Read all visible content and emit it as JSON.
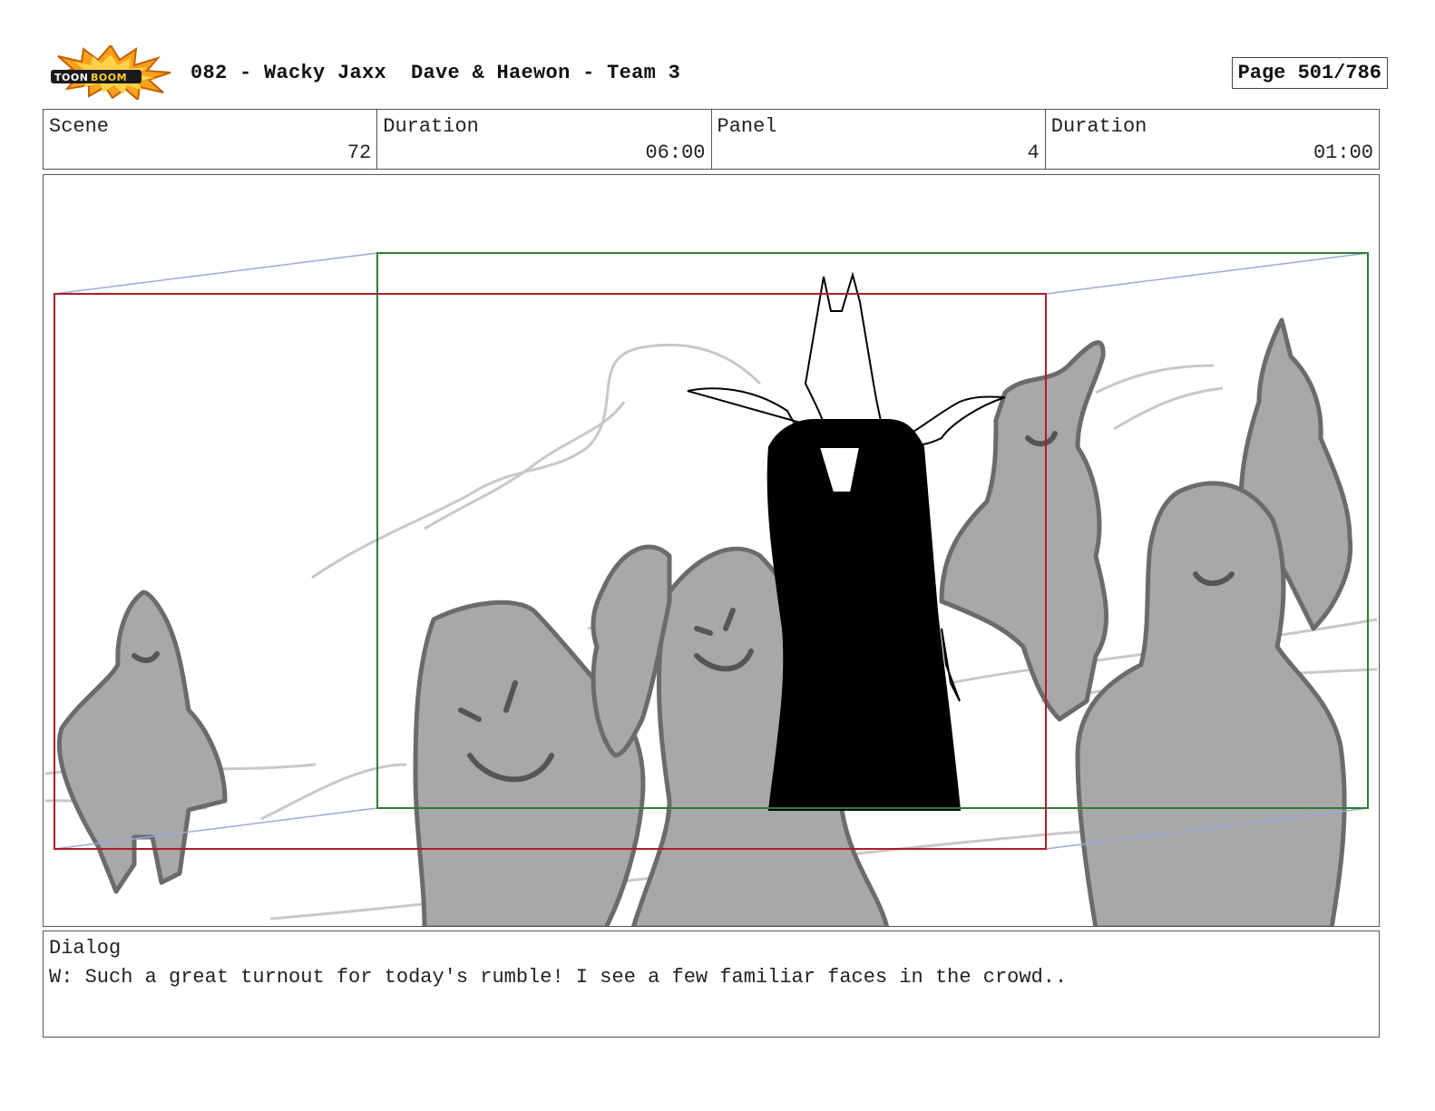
{
  "header": {
    "logo_text": "TOONBOOM",
    "title": "082 - Wacky Jaxx  Dave & Haewon - Team 3",
    "page": "Page 501/786"
  },
  "info": {
    "scene_label": "Scene",
    "scene_value": "72",
    "scene_duration_label": "Duration",
    "scene_duration_value": "06:00",
    "panel_label": "Panel",
    "panel_value": "4",
    "panel_duration_label": "Duration",
    "panel_duration_value": "01:00"
  },
  "dialog": {
    "label": "Dialog",
    "text": "W: Such a great turnout for today's rumble! I see a few familiar faces in the crowd.."
  },
  "colors": {
    "camera_start_frame": "#b01c2a",
    "camera_end_frame": "#2e7d32",
    "camera_path": "#9fa8da",
    "crowd_fill": "#a8a8a8",
    "crowd_outline": "#6b6b6b",
    "villain": "#000000"
  }
}
